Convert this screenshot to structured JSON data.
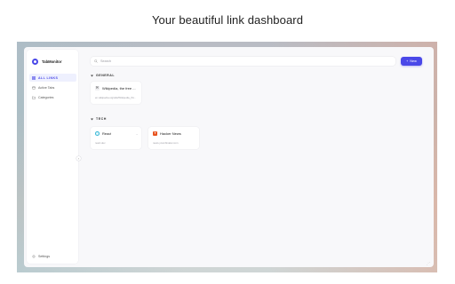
{
  "headline": "Your beautiful link dashboard",
  "app": {
    "name": "TabMonitor"
  },
  "sidebar": {
    "items": [
      {
        "label": "ALL LINKS",
        "icon": "grid-icon",
        "active": true
      },
      {
        "label": "Active Tabs",
        "icon": "tabs-icon",
        "active": false
      },
      {
        "label": "Categories",
        "icon": "folder-icon",
        "active": false
      }
    ],
    "settings_label": "Settings",
    "collapse_glyph": "‹"
  },
  "search": {
    "placeholder": "Search"
  },
  "toolbar": {
    "new_label": "New",
    "new_glyph": "+"
  },
  "sections": [
    {
      "title": "GENERAL",
      "cards": [
        {
          "title": "Wikipedia, the free ...",
          "url": "en.wikipedia.org/wiki/Wikipedia_(Si...",
          "favicon": "W"
        }
      ]
    },
    {
      "title": "TECH",
      "cards": [
        {
          "title": "React",
          "url": "react.dev",
          "favicon": ""
        },
        {
          "title": "Hacker News",
          "url": "news.ycombinator.com",
          "favicon": "Y"
        }
      ]
    }
  ],
  "colors": {
    "accent": "#4a48e8",
    "hn": "#e8531f",
    "react": "#39b8d6"
  }
}
